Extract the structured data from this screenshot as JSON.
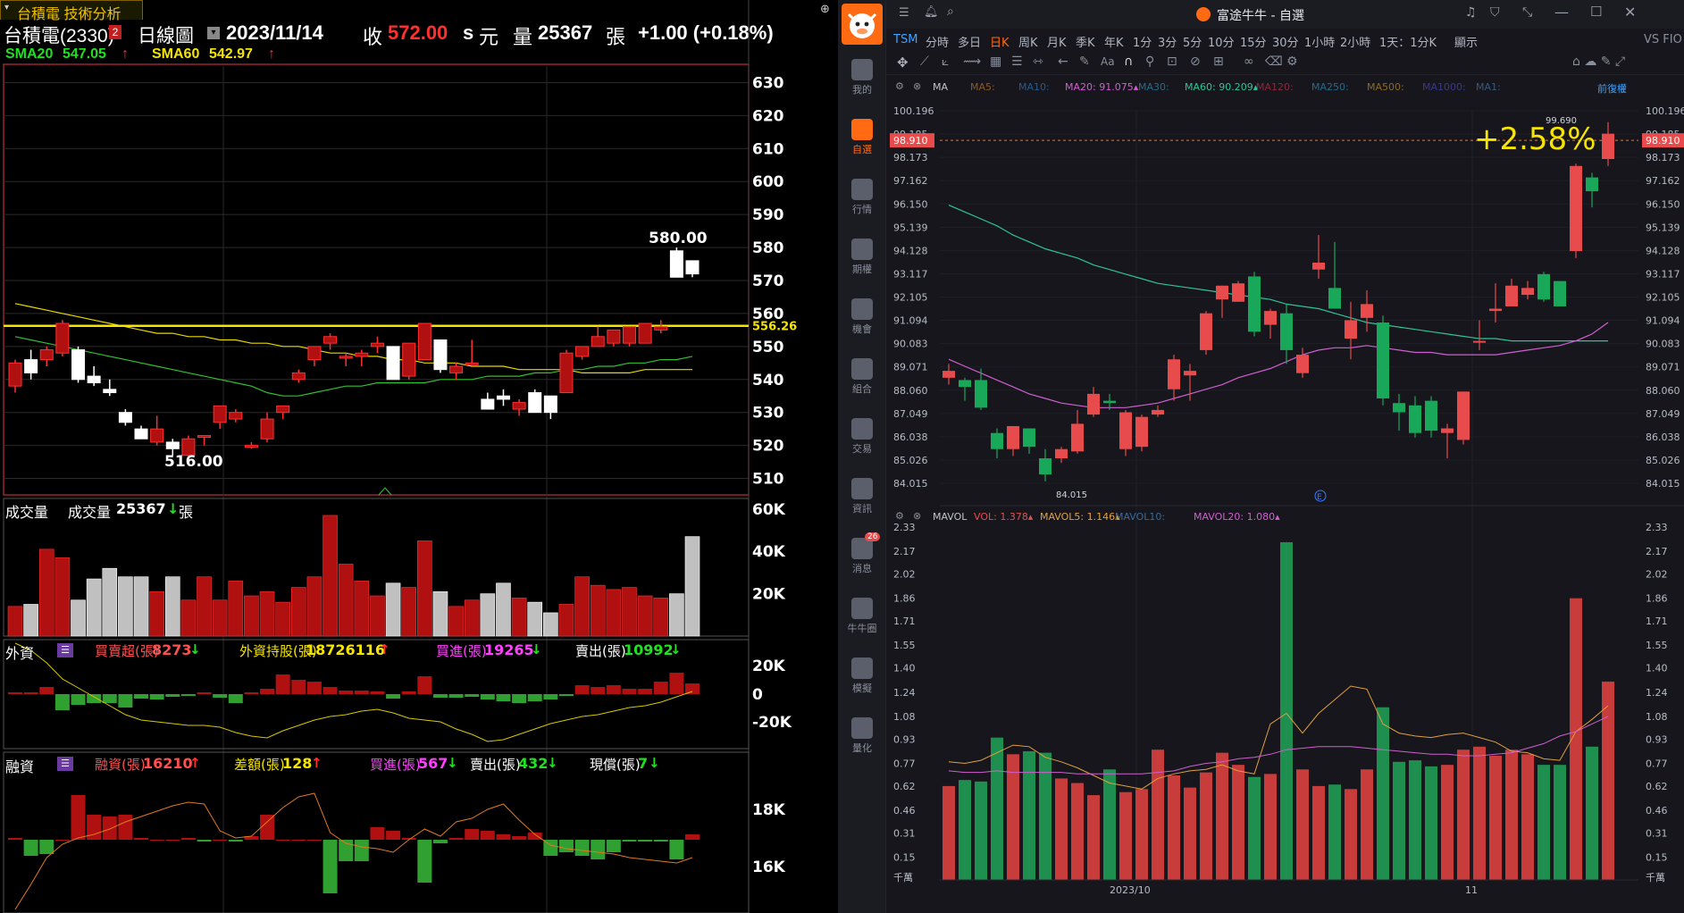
{
  "left": {
    "tab_title": "台積電 技術分析",
    "header": {
      "stock": "台積電(2330)",
      "badge": "2",
      "period": "日線圖",
      "date": "2023/11/14",
      "close_label": "收",
      "close_value": "572.00",
      "unit_s": "s",
      "unit": "元",
      "vol_label": "量",
      "vol_value": "25367",
      "vol_unit": "張",
      "change": "+1.00 (+0.18%)"
    },
    "ma": {
      "sma20_label": "SMA20",
      "sma20_value": "547.05",
      "sma60_label": "SMA60",
      "sma60_value": "542.97",
      "arrow_up": "↑"
    },
    "price_axis": [
      "630",
      "620",
      "610",
      "600",
      "590",
      "580",
      "570",
      "560",
      "550",
      "540",
      "530",
      "520",
      "510"
    ],
    "line_label": "556.26",
    "high_label": "580.00",
    "low_label": "516.00",
    "volume_panel": {
      "title": "成交量",
      "label": "成交量",
      "value": "25367",
      "arrow": "↓",
      "unit": "張",
      "axis": [
        "60K",
        "40K",
        "20K"
      ]
    },
    "foreign_panel": {
      "title": "外資",
      "items": [
        {
          "label": "買賣超(張)",
          "value": "8273",
          "arrow": "↓"
        },
        {
          "label": "外資持股(張)",
          "value": "18726116",
          "arrow": "↑"
        },
        {
          "label": "買進(張)",
          "value": "19265",
          "arrow": "↓"
        },
        {
          "label": "賣出(張)",
          "value": "10992",
          "arrow": "↓"
        }
      ],
      "axis": [
        "20K",
        "0",
        "-20K"
      ]
    },
    "margin_panel": {
      "title": "融資",
      "items": [
        {
          "label": "融資(張)",
          "value": "16210",
          "arrow": "↑"
        },
        {
          "label": "差額(張)",
          "value": "128",
          "arrow": "↑"
        },
        {
          "label": "買進(張)",
          "value": "567",
          "arrow": "↓"
        },
        {
          "label": "賣出(張)",
          "value": "432",
          "arrow": "↓"
        },
        {
          "label": "現償(張)",
          "value": "7",
          "arrow": "↓"
        }
      ],
      "axis": [
        "18K",
        "16K"
      ]
    }
  },
  "right": {
    "window_title": "富途牛牛 - 自選",
    "symbol": "TSM",
    "periods": [
      "分時",
      "多日",
      "日K",
      "周K",
      "月K",
      "季K",
      "年K",
      "1分",
      "3分",
      "5分",
      "10分",
      "15分",
      "30分",
      "1小時",
      "2小時",
      "1天：1分K",
      "顯示"
    ],
    "active_period": "日K",
    "vs_label": "VS FIO",
    "sidebar": [
      {
        "label": "我的",
        "icon": "user-icon"
      },
      {
        "label": "自選",
        "icon": "bar-chart-icon"
      },
      {
        "label": "行情",
        "icon": "trend-icon"
      },
      {
        "label": "期權",
        "icon": "options-icon"
      },
      {
        "label": "機會",
        "icon": "chest-icon"
      },
      {
        "label": "組合",
        "icon": "pie-icon"
      },
      {
        "label": "交易",
        "icon": "trade-icon"
      },
      {
        "label": "資訊",
        "icon": "news-icon"
      },
      {
        "label": "消息",
        "icon": "message-icon",
        "badge": "26"
      },
      {
        "label": "牛牛圈",
        "icon": "circle-icon"
      },
      {
        "label": "模擬",
        "icon": "game-icon"
      },
      {
        "label": "量化",
        "icon": "code-icon"
      }
    ],
    "ma_bar": {
      "name": "MA",
      "items": [
        {
          "label": "MA5:",
          "value": "",
          "color": "#8a5a2a"
        },
        {
          "label": "MA10:",
          "value": "",
          "color": "#2a5a8a"
        },
        {
          "label": "MA20:",
          "value": "91.075",
          "color": "#d05fd0"
        },
        {
          "label": "MA30:",
          "value": "",
          "color": "#2a6a8a"
        },
        {
          "label": "MA60:",
          "value": "90.209",
          "color": "#2fc39a"
        },
        {
          "label": "MA120:",
          "value": "",
          "color": "#8a2a3a"
        },
        {
          "label": "MA250:",
          "value": "",
          "color": "#2a6a8a"
        },
        {
          "label": "MA500:",
          "value": "",
          "color": "#8a6a2a"
        },
        {
          "label": "MA1000:",
          "value": "",
          "color": "#3a3a8a"
        },
        {
          "label": "MA1:",
          "value": "",
          "color": "#3a5a7a"
        }
      ],
      "adjust": "前復權"
    },
    "price_axis": [
      "100.196",
      "99.185",
      "98.173",
      "97.162",
      "96.150",
      "95.139",
      "94.128",
      "93.117",
      "92.105",
      "91.094",
      "90.083",
      "89.071",
      "88.060",
      "87.049",
      "86.038",
      "85.026",
      "84.015"
    ],
    "current_price": "98.910",
    "high_label": "99.690",
    "low_label": "84.015",
    "change_pct": "+2.58%",
    "earnings_marker": "E",
    "vol_bar": {
      "name": "MAVOL",
      "items": [
        {
          "label": "VOL:",
          "value": "1.378",
          "color": "#e05050"
        },
        {
          "label": "MAVOL5:",
          "value": "1.146",
          "color": "#e0a040"
        },
        {
          "label": "MAVOL10:",
          "value": "",
          "color": "#3a6a9a"
        },
        {
          "label": "MAVOL20:",
          "value": "1.080",
          "color": "#d05fd0"
        }
      ]
    },
    "vol_axis": [
      "2.33",
      "2.17",
      "2.02",
      "1.86",
      "1.71",
      "1.55",
      "1.40",
      "1.24",
      "1.08",
      "0.93",
      "0.77",
      "0.62",
      "0.46",
      "0.31",
      "0.15",
      "千萬"
    ],
    "date_axis": [
      "2023/10",
      "11"
    ]
  },
  "colors": {
    "tw_up": "#b01010",
    "tw_up_border": "#ff3030",
    "tw_down": "#ffffff",
    "futu_up": "#e84b4b",
    "futu_down": "#19a85a",
    "yellow": "#f5e500"
  },
  "chart_data": [
    {
      "type": "candlestick",
      "title": "台積電(2330) 日線圖",
      "ylim": [
        505,
        635
      ],
      "candles": [
        {
          "o": 538,
          "h": 546,
          "l": 536,
          "c": 545
        },
        {
          "o": 546,
          "h": 549,
          "l": 540,
          "c": 542
        },
        {
          "o": 546,
          "h": 550,
          "l": 544,
          "c": 549
        },
        {
          "o": 548,
          "h": 558,
          "l": 547,
          "c": 557
        },
        {
          "o": 549,
          "h": 550,
          "l": 539,
          "c": 540
        },
        {
          "o": 541,
          "h": 544,
          "l": 538,
          "c": 539
        },
        {
          "o": 537,
          "h": 540,
          "l": 535,
          "c": 536
        },
        {
          "o": 530,
          "h": 531,
          "l": 526,
          "c": 527
        },
        {
          "o": 525,
          "h": 526,
          "l": 522,
          "c": 522
        },
        {
          "o": 521,
          "h": 529,
          "l": 520,
          "c": 525
        },
        {
          "o": 521,
          "h": 522,
          "l": 517,
          "c": 519
        },
        {
          "o": 517,
          "h": 523,
          "l": 516,
          "c": 522
        },
        {
          "o": 523,
          "h": 523,
          "l": 520,
          "c": 523
        },
        {
          "o": 527,
          "h": 532,
          "l": 525,
          "c": 532
        },
        {
          "o": 528,
          "h": 531,
          "l": 527,
          "c": 530
        },
        {
          "o": 520,
          "h": 521,
          "l": 519,
          "c": 520
        },
        {
          "o": 522,
          "h": 530,
          "l": 521,
          "c": 528
        },
        {
          "o": 530,
          "h": 532,
          "l": 528,
          "c": 532
        },
        {
          "o": 540,
          "h": 543,
          "l": 539,
          "c": 542
        },
        {
          "o": 546,
          "h": 548,
          "l": 544,
          "c": 550
        },
        {
          "o": 551,
          "h": 554,
          "l": 549,
          "c": 553
        },
        {
          "o": 547,
          "h": 548,
          "l": 544,
          "c": 547
        },
        {
          "o": 547,
          "h": 549,
          "l": 544,
          "c": 548
        },
        {
          "o": 550,
          "h": 553,
          "l": 548,
          "c": 551
        },
        {
          "o": 550,
          "h": 550,
          "l": 540,
          "c": 540
        },
        {
          "o": 541,
          "h": 551,
          "l": 540,
          "c": 551
        },
        {
          "o": 546,
          "h": 557,
          "l": 546,
          "c": 557
        },
        {
          "o": 552,
          "h": 552,
          "l": 542,
          "c": 543
        },
        {
          "o": 542,
          "h": 545,
          "l": 540,
          "c": 544
        },
        {
          "o": 545,
          "h": 552,
          "l": 545,
          "c": 545
        },
        {
          "o": 534,
          "h": 536,
          "l": 531,
          "c": 531
        },
        {
          "o": 535,
          "h": 537,
          "l": 532,
          "c": 534
        },
        {
          "o": 531,
          "h": 534,
          "l": 529,
          "c": 533
        },
        {
          "o": 536,
          "h": 537,
          "l": 530,
          "c": 530
        },
        {
          "o": 535,
          "h": 535,
          "l": 528,
          "c": 530
        },
        {
          "o": 536,
          "h": 549,
          "l": 536,
          "c": 548
        },
        {
          "o": 547,
          "h": 550,
          "l": 546,
          "c": 550
        },
        {
          "o": 550,
          "h": 556,
          "l": 550,
          "c": 553
        },
        {
          "o": 551,
          "h": 555,
          "l": 550,
          "c": 555
        },
        {
          "o": 551,
          "h": 556,
          "l": 550,
          "c": 556
        },
        {
          "o": 551,
          "h": 557,
          "l": 551,
          "c": 557
        },
        {
          "o": 555,
          "h": 558,
          "l": 554,
          "c": 556
        },
        {
          "o": 579,
          "h": 580,
          "l": 571,
          "c": 571
        },
        {
          "o": 576,
          "h": 576,
          "l": 571,
          "c": 572
        }
      ],
      "sma20": [
        553,
        552,
        551,
        550,
        549,
        548,
        547,
        546,
        545,
        544,
        543,
        542,
        541,
        540,
        539,
        538,
        536,
        535,
        535,
        536,
        537,
        538,
        538,
        539,
        539,
        539,
        539,
        540,
        540,
        540,
        541,
        541,
        541,
        542,
        542,
        543,
        543,
        544,
        544,
        545,
        545,
        546,
        546,
        547
      ],
      "sma60": [
        563,
        562,
        561,
        560,
        559,
        558,
        557,
        556,
        555,
        554,
        554,
        553,
        553,
        552,
        552,
        551,
        551,
        550,
        550,
        549,
        548,
        548,
        547,
        547,
        546,
        546,
        545,
        545,
        545,
        544,
        544,
        544,
        543,
        543,
        543,
        543,
        542,
        542,
        542,
        542,
        543,
        543,
        543,
        543
      ],
      "volume": [
        14,
        15,
        41,
        37,
        17,
        27,
        32,
        28,
        28,
        21,
        28,
        17,
        28,
        17,
        26,
        19,
        21,
        16,
        23,
        28,
        57,
        34,
        26,
        19,
        25,
        23,
        45,
        21,
        14,
        17,
        20,
        25,
        18,
        16,
        11,
        15,
        28,
        24,
        22,
        23,
        19,
        18,
        20,
        47,
        26
      ]
    },
    {
      "type": "candlestick",
      "title": "TSM 日K",
      "ylim": [
        84.015,
        100.196
      ],
      "candles": [
        {
          "o": 88.6,
          "h": 89.2,
          "l": 88.3,
          "c": 88.9
        },
        {
          "o": 88.5,
          "h": 88.6,
          "l": 87.6,
          "c": 88.2
        },
        {
          "o": 88.5,
          "h": 89.0,
          "l": 87.2,
          "c": 87.3
        },
        {
          "o": 86.2,
          "h": 86.4,
          "l": 85.1,
          "c": 85.5
        },
        {
          "o": 85.5,
          "h": 86.5,
          "l": 85.2,
          "c": 86.5
        },
        {
          "o": 86.4,
          "h": 86.4,
          "l": 85.3,
          "c": 85.6
        },
        {
          "o": 85.1,
          "h": 85.5,
          "l": 84.1,
          "c": 84.4
        },
        {
          "o": 85.1,
          "h": 85.6,
          "l": 84.9,
          "c": 85.5
        },
        {
          "o": 85.4,
          "h": 87.2,
          "l": 85.3,
          "c": 86.6
        },
        {
          "o": 87.0,
          "h": 88.2,
          "l": 86.9,
          "c": 87.9
        },
        {
          "o": 87.6,
          "h": 87.9,
          "l": 87.2,
          "c": 87.5
        },
        {
          "o": 85.5,
          "h": 87.2,
          "l": 85.2,
          "c": 87.1
        },
        {
          "o": 85.6,
          "h": 87.0,
          "l": 85.4,
          "c": 86.9
        },
        {
          "o": 87.0,
          "h": 87.4,
          "l": 86.9,
          "c": 87.2
        },
        {
          "o": 88.1,
          "h": 89.6,
          "l": 87.6,
          "c": 89.4
        },
        {
          "o": 88.7,
          "h": 89.2,
          "l": 87.6,
          "c": 88.9
        },
        {
          "o": 89.8,
          "h": 91.5,
          "l": 89.6,
          "c": 91.4
        },
        {
          "o": 92.0,
          "h": 92.6,
          "l": 91.2,
          "c": 92.6
        },
        {
          "o": 91.9,
          "h": 92.8,
          "l": 91.9,
          "c": 92.7
        },
        {
          "o": 93.0,
          "h": 93.2,
          "l": 90.4,
          "c": 90.6
        },
        {
          "o": 90.9,
          "h": 91.6,
          "l": 90.3,
          "c": 91.5
        },
        {
          "o": 91.4,
          "h": 91.8,
          "l": 89.2,
          "c": 89.8
        },
        {
          "o": 88.8,
          "h": 89.9,
          "l": 88.6,
          "c": 89.6
        },
        {
          "o": 93.3,
          "h": 94.8,
          "l": 92.9,
          "c": 93.6
        },
        {
          "o": 92.5,
          "h": 94.5,
          "l": 91.7,
          "c": 91.6
        },
        {
          "o": 90.3,
          "h": 91.9,
          "l": 89.4,
          "c": 91.1
        },
        {
          "o": 91.2,
          "h": 92.4,
          "l": 90.6,
          "c": 91.8
        },
        {
          "o": 91.0,
          "h": 91.3,
          "l": 87.4,
          "c": 87.7
        },
        {
          "o": 87.5,
          "h": 87.9,
          "l": 86.3,
          "c": 87.1
        },
        {
          "o": 87.4,
          "h": 87.8,
          "l": 86.0,
          "c": 86.2
        },
        {
          "o": 87.6,
          "h": 87.8,
          "l": 86.0,
          "c": 86.3
        },
        {
          "o": 86.2,
          "h": 86.6,
          "l": 85.1,
          "c": 86.4
        },
        {
          "o": 85.9,
          "h": 88.0,
          "l": 85.7,
          "c": 88.0
        },
        {
          "o": 90.2,
          "h": 91.1,
          "l": 89.8,
          "c": 90.2
        },
        {
          "o": 91.5,
          "h": 92.7,
          "l": 91.0,
          "c": 91.6
        },
        {
          "o": 91.7,
          "h": 92.9,
          "l": 91.7,
          "c": 92.6
        },
        {
          "o": 92.2,
          "h": 92.8,
          "l": 92.0,
          "c": 92.5
        },
        {
          "o": 93.1,
          "h": 93.2,
          "l": 91.9,
          "c": 92.0
        },
        {
          "o": 92.8,
          "h": 92.8,
          "l": 91.7,
          "c": 91.7
        },
        {
          "o": 94.1,
          "h": 97.9,
          "l": 93.8,
          "c": 97.8
        },
        {
          "o": 97.3,
          "h": 97.5,
          "l": 96.0,
          "c": 96.7
        },
        {
          "o": 98.1,
          "h": 99.7,
          "l": 97.8,
          "c": 99.2
        }
      ],
      "ma20": [
        89.4,
        89.1,
        88.8,
        88.5,
        88.2,
        87.9,
        87.7,
        87.5,
        87.4,
        87.3,
        87.3,
        87.3,
        87.4,
        87.5,
        87.7,
        87.9,
        88.1,
        88.3,
        88.6,
        88.8,
        89.0,
        89.3,
        89.6,
        89.8,
        89.9,
        89.9,
        90.0,
        89.9,
        89.8,
        89.7,
        89.7,
        89.6,
        89.6,
        89.6,
        89.6,
        89.7,
        89.8,
        89.9,
        90.0,
        90.2,
        90.5,
        91.0
      ],
      "ma60": [
        96.1,
        95.8,
        95.5,
        95.2,
        94.8,
        94.5,
        94.2,
        94.0,
        93.8,
        93.5,
        93.3,
        93.1,
        92.9,
        92.7,
        92.6,
        92.5,
        92.4,
        92.3,
        92.2,
        92.1,
        92.0,
        91.8,
        91.7,
        91.6,
        91.4,
        91.2,
        91.0,
        90.9,
        90.8,
        90.7,
        90.6,
        90.5,
        90.4,
        90.3,
        90.3,
        90.2,
        90.2,
        90.2,
        90.2,
        90.2,
        90.2,
        90.2
      ],
      "volume": [
        0.62,
        0.66,
        0.65,
        0.94,
        0.83,
        0.85,
        0.84,
        0.67,
        0.64,
        0.56,
        0.73,
        0.58,
        0.6,
        0.86,
        0.69,
        0.61,
        0.71,
        0.84,
        0.76,
        0.68,
        0.7,
        2.23,
        0.73,
        0.62,
        0.63,
        0.6,
        0.73,
        1.14,
        0.78,
        0.79,
        0.75,
        0.76,
        0.86,
        0.88,
        0.82,
        0.86,
        0.83,
        0.76,
        0.76,
        1.86,
        0.88,
        1.31
      ],
      "mavol5": [
        0.78,
        0.77,
        0.79,
        0.84,
        0.89,
        0.88,
        0.81,
        0.78,
        0.74,
        0.69,
        0.64,
        0.62,
        0.6,
        0.67,
        0.7,
        0.72,
        0.73,
        0.76,
        0.72,
        0.7,
        1.03,
        1.1,
        0.97,
        1.1,
        1.19,
        1.28,
        1.26,
        1.03,
        0.97,
        0.95,
        0.94,
        0.96,
        0.97,
        0.94,
        0.91,
        0.85,
        0.84,
        0.8,
        0.79,
        0.98,
        1.06,
        1.15
      ],
      "mavol20": [
        0.72,
        0.71,
        0.71,
        0.72,
        0.71,
        0.71,
        0.71,
        0.71,
        0.7,
        0.7,
        0.7,
        0.7,
        0.7,
        0.71,
        0.72,
        0.75,
        0.77,
        0.78,
        0.8,
        0.81,
        0.83,
        0.86,
        0.87,
        0.88,
        0.88,
        0.88,
        0.87,
        0.86,
        0.85,
        0.84,
        0.83,
        0.83,
        0.82,
        0.82,
        0.83,
        0.84,
        0.87,
        0.9,
        0.95,
        0.98,
        1.03,
        1.08
      ]
    }
  ]
}
